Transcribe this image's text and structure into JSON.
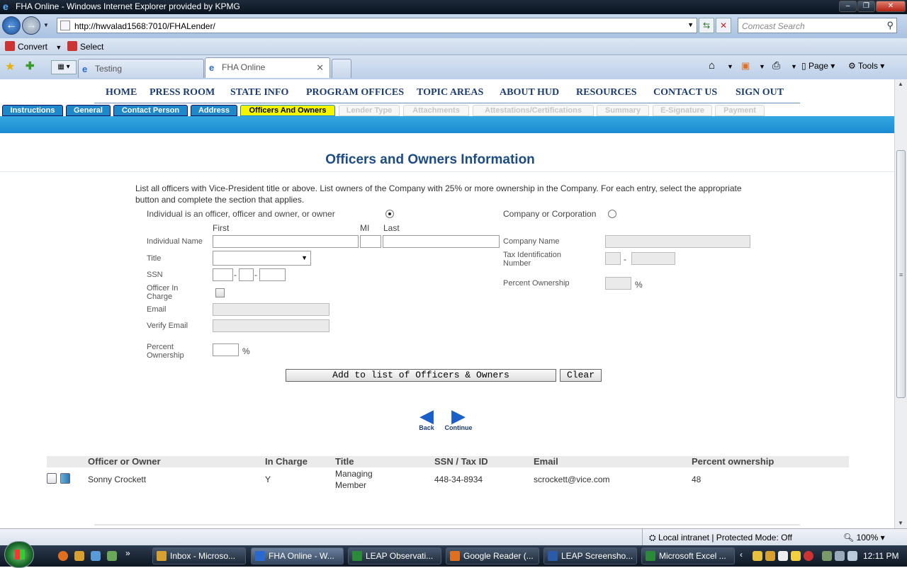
{
  "window": {
    "title": "FHA Online - Windows Internet Explorer provided by KPMG"
  },
  "address": {
    "url": "http://hwvalad1568:7010/FHALender/",
    "search_placeholder": "Comcast Search"
  },
  "commandbar": {
    "convert": "Convert",
    "select": "Select"
  },
  "browser_tabs": [
    {
      "label": "Testing"
    },
    {
      "label": "FHA Online"
    }
  ],
  "tools": {
    "page": "Page",
    "tools": "Tools"
  },
  "hud_nav": [
    "HOME",
    "PRESS ROOM",
    "STATE INFO",
    "PROGRAM OFFICES",
    "TOPIC AREAS",
    "ABOUT HUD",
    "RESOURCES",
    "CONTACT US",
    "SIGN OUT"
  ],
  "form_tabs": [
    {
      "label": "Instructions",
      "state": "enabled"
    },
    {
      "label": "General",
      "state": "enabled"
    },
    {
      "label": "Contact Person",
      "state": "enabled"
    },
    {
      "label": "Address",
      "state": "enabled"
    },
    {
      "label": "Officers And Owners",
      "state": "current"
    },
    {
      "label": "Lender Type",
      "state": "disabled"
    },
    {
      "label": "Attachments",
      "state": "disabled"
    },
    {
      "label": "Attestations/Certifications",
      "state": "disabled"
    },
    {
      "label": "Summary",
      "state": "disabled"
    },
    {
      "label": "E-Signature",
      "state": "disabled"
    },
    {
      "label": "Payment",
      "state": "disabled"
    }
  ],
  "heading": "Officers and Owners Information",
  "instructions": "List all officers with Vice-President title or above. List owners of the Company with 25% or more ownership in the Company.  For each entry, select the appropriate button and complete the section that applies.",
  "individual": {
    "radio_label": "Individual is an officer, officer and owner, or owner",
    "selected": true,
    "col_first": "First",
    "col_mi": "MI",
    "col_last": "Last",
    "name_label": "Individual Name",
    "title_label": "Title",
    "ssn_label": "SSN",
    "officer_in_charge_label": "Officer In Charge",
    "email_label": "Email",
    "verify_email_label": "Verify Email",
    "percent_label": "Percent Ownership",
    "percent_sign": "%",
    "officer_in_charge_checked": false
  },
  "company": {
    "radio_label": "Company or Corporation",
    "selected": false,
    "name_label": "Company Name",
    "tin_label": "Tax Identification Number",
    "percent_label": "Percent Ownership",
    "percent_sign": "%"
  },
  "buttons": {
    "add": "Add to list of Officers & Owners",
    "clear": "Clear",
    "back": "Back",
    "continue": "Continue"
  },
  "table": {
    "headers": [
      "Officer or Owner",
      "In Charge",
      "Title",
      "SSN / Tax ID",
      "Email",
      "Percent ownership"
    ],
    "rows": [
      {
        "name": "Sonny Crockett",
        "in_charge": "Y",
        "title_line1": "Managing",
        "title_line2": "Member",
        "ssn": "448-34-8934",
        "email": "scrockett@vice.com",
        "percent": "48"
      }
    ]
  },
  "status": {
    "zone": "Local intranet | Protected Mode: Off",
    "zoom": "100%"
  },
  "taskbar": {
    "items": [
      {
        "label": "Inbox - Microso...",
        "color": "#d8a030"
      },
      {
        "label": "FHA Online - W...",
        "color": "#2a6ad0"
      },
      {
        "label": "LEAP Observati...",
        "color": "#2a8a3a"
      },
      {
        "label": "Google Reader (...",
        "color": "#e07020"
      },
      {
        "label": "LEAP Screensho...",
        "color": "#2a5aa8"
      },
      {
        "label": "Microsoft Excel ...",
        "color": "#2a8a3a"
      }
    ],
    "clock": "12:11 PM"
  }
}
